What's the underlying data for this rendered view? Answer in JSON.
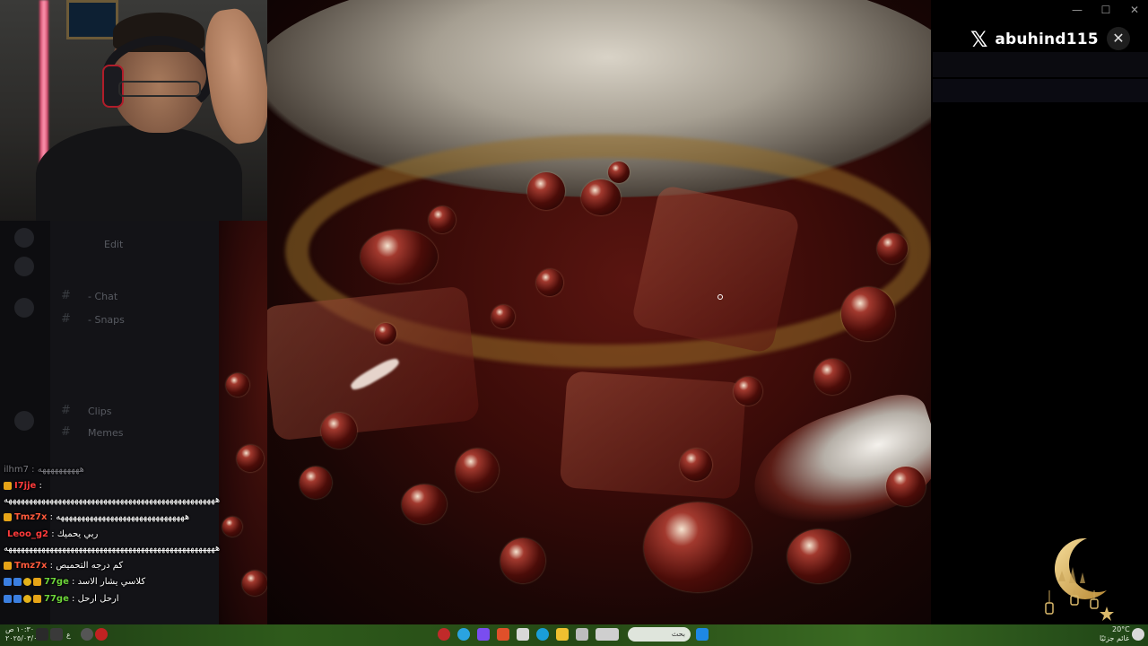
{
  "stream": {
    "x_handle": "abuhind115",
    "x_logo": "𝕏",
    "close_symbol": "✕",
    "window_controls": [
      "—",
      "☐",
      "✕"
    ]
  },
  "discord_ghost": {
    "channels": [
      "- Chat",
      "- Snaps",
      "Clips",
      "Memes",
      "Edit"
    ]
  },
  "chat": {
    "messages": [
      {
        "user": "ilhm7",
        "text": "ههههههههههه",
        "style": "faded",
        "badges": []
      },
      {
        "user": "I7jje",
        "text": "",
        "style": "red",
        "badges": [
          "sub"
        ]
      },
      {
        "user": "",
        "text": "هههههههههههههههههههههههههههههههههههههههههههههههههههه",
        "style": "plain",
        "badges": []
      },
      {
        "user": "Tmz7x",
        "text": "هههههههههههههههههههههههههههههههه",
        "style": "orange",
        "badges": [
          "sub"
        ]
      },
      {
        "user": "Leoo_g2",
        "text": "ربي يحميك",
        "style": "red",
        "badges": []
      },
      {
        "user": "",
        "text": "هههههههههههههههههههههههههههههههههههههههههههههههههههه",
        "style": "plain",
        "badges": []
      },
      {
        "user": "Tmz7x",
        "text": "كم درجه التحميص",
        "style": "orange",
        "badges": [
          "sub"
        ]
      },
      {
        "user": "77ge",
        "text": "كلاسي يشار الاسد",
        "style": "green",
        "badges": [
          "blue",
          "blue",
          "gold",
          "sub"
        ]
      },
      {
        "user": "77ge",
        "text": "ارحل ارحل",
        "style": "green",
        "badges": [
          "blue",
          "blue",
          "gold",
          "sub"
        ]
      }
    ]
  },
  "taskbar": {
    "search_placeholder": "بحث",
    "time": "١٠:٣٠ ص",
    "date": "٢٠٢٥/٠٣/٠١",
    "weather": "20°C",
    "weather_desc": "غائم جزئيًا",
    "lang": "ع"
  },
  "colors": {
    "accent_red": "#ff3b3b",
    "accent_green": "#6dd43a",
    "taskbar_green": "#2e5a1b"
  }
}
